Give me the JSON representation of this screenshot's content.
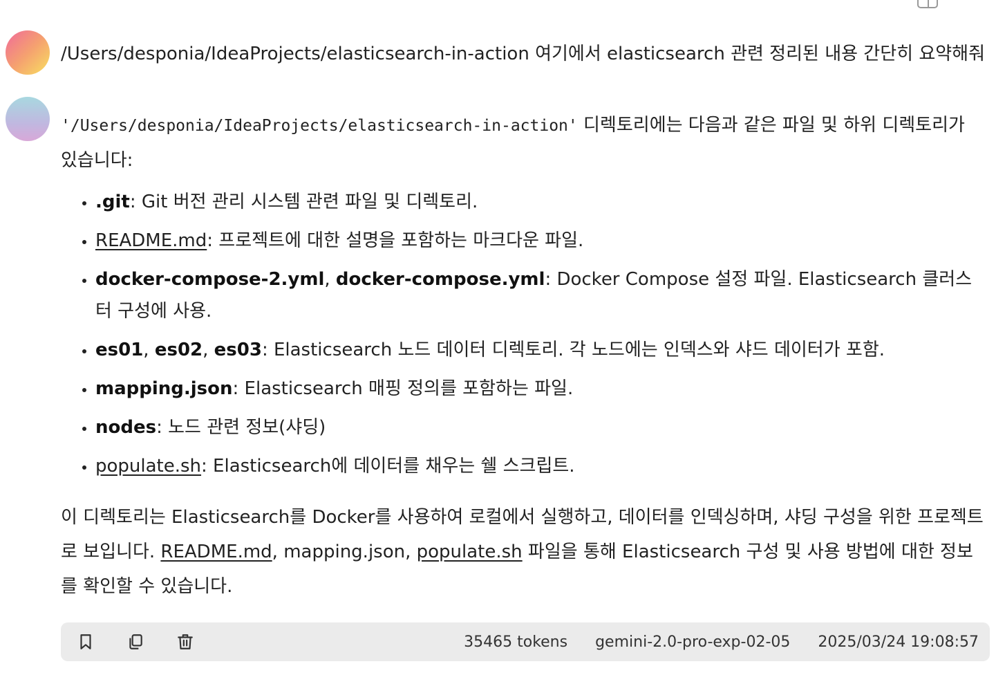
{
  "top_icons": {
    "panel": "panel-layout-icon",
    "more": "more-horizontal-icon",
    "more_glyph": "···"
  },
  "user_message": {
    "text": "/Users/desponia/IdeaProjects/elasticsearch-in-action 여기에서 elasticsearch 관련 정리된 내용 간단히 요약해줘"
  },
  "assistant_message": {
    "intro_path": "'/Users/desponia/IdeaProjects/elasticsearch-in-action'",
    "intro_rest": " 디렉토리에는 다음과 같은 파일 및 하위 디렉토리가 있습니다:",
    "items": [
      {
        "name": ".git",
        "rest": ": Git 버전 관리 시스템 관련 파일 및 디렉토리."
      },
      {
        "name": "README.md",
        "rest": ": 프로젝트에 대한 설명을 포함하는 마크다운 파일."
      },
      {
        "name": "docker-compose-2.yml",
        "sep": ", ",
        "name2": "docker-compose.yml",
        "rest": ": Docker Compose 설정 파일. Elasticsearch 클러스터 구성에 사용."
      },
      {
        "name": "es01",
        "sep": ", ",
        "name2": "es02",
        "sep2": ", ",
        "name3": "es03",
        "rest": ": Elasticsearch 노드 데이터 디렉토리. 각 노드에는 인덱스와 샤드 데이터가 포함."
      },
      {
        "name": "mapping.json",
        "rest": ": Elasticsearch 매핑 정의를 포함하는 파일."
      },
      {
        "name": "nodes",
        "rest": ": 노드 관련 정보(샤딩)"
      },
      {
        "name": "populate.sh",
        "rest": ": Elasticsearch에 데이터를 채우는 쉘 스크립트."
      }
    ],
    "summary_part1": "이 디렉토리는 Elasticsearch를 Docker를 사용하여 로컬에서 실행하고, 데이터를 인덱싱하며, 샤딩 구성을 위한 프로젝트로 보입니다. ",
    "summary_link1": "README.md",
    "summary_part2": ", mapping.json, ",
    "summary_link2": "populate.sh",
    "summary_part3": " 파일을 통해 Elasticsearch 구성 및 사용 방법에 대한 정보를 확인할 수 있습니다."
  },
  "footer": {
    "tokens": "35465 tokens",
    "model": "gemini-2.0-pro-exp-02-05",
    "timestamp": "2025/03/24 19:08:57",
    "icons": [
      "bookmark-icon",
      "copy-icon",
      "trash-icon"
    ]
  }
}
